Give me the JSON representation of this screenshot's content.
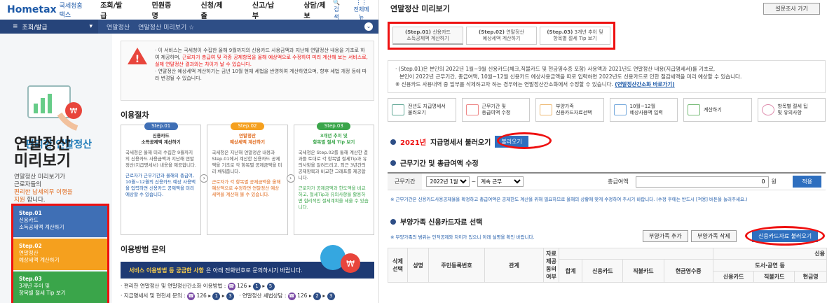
{
  "header": {
    "logo": "Hometax",
    "logo_sub": "국세청홈택스",
    "menu": [
      "조회/발급",
      "민원증명",
      "신청/제출",
      "신고/납부",
      "상담/제보"
    ],
    "search_label": "검색",
    "allmenu_label": "전체메뉴"
  },
  "navbar": {
    "section": "조회/발급",
    "crumb1": "연말정산",
    "crumb2": "연말정산 미리보기"
  },
  "side": {
    "easy_title": "편리한 연말정산",
    "big_title_1": "연말정산",
    "big_title_2": "미리보기",
    "desc_1": "연말정산 미리보기가",
    "desc_2": "근로자들의",
    "desc_hl": "편리한 납세의무 이행을",
    "desc_3": "지원",
    "desc_4": "합니다.",
    "steps": [
      {
        "n": "Step.01",
        "l1": "신용카드",
        "l2": "소득공제액 계산하기"
      },
      {
        "n": "Step.02",
        "l1": "연말정산",
        "l2": "예상세액 계산하기"
      },
      {
        "n": "Step.03",
        "l1": "3개년 추이 및",
        "l2": "항목별 절세 Tip 보기"
      }
    ]
  },
  "notice": {
    "p1a": "· 이 서비스는 국세청이 수집한 올해 9월까지의 신용카드 사용금액과 지난해 연말정산 내용을 기초로 하여 제공하며,",
    "p1b": "근로자가 총급여 및 각종 공제항목을 올해 예상액으로 수정하여 미리 계산해 보는 서비스로, 실제 연말정산 결과와는 차이가 날 수 있습니다.",
    "p2": "· 연말정산 예상세액 계산하기는 금년 10월 현재 세법을 반영하여 계산하였으며, 향후 세법 개정 등에 따라 변경될 수 있습니다."
  },
  "procedure": {
    "title": "이용절차",
    "cards": [
      {
        "badge": "Step.01",
        "t1": "신용카드",
        "t2": "소득공제액 계산하기",
        "body": "국세청은 올해 미리 수집한 9월까지의 신용카드 사용금액과 지난해 연말정산(지급명세서) 내용을 제공합니다.",
        "foot": "근로자가 근무기간과 올해의 총급여, 10월~12월의 신용카드 예상 사용액을 입력하면 신용카드 공제액을 미리 예상할 수 있습니다."
      },
      {
        "badge": "Step.02",
        "t1": "연말정산",
        "t2": "예상세액 계산하기",
        "body": "국세청은 지난해 연말정산 내용과 Step.01에서 계산한 신용카드 공제액을 기초로 각 항목별 공제금액을 미리 채워줍니다.",
        "foot": "근로자가 각 항목별 공제금액을 올해예상액으로 수정하면 연말정산 예상세액을 계산해 볼 수 있습니다."
      },
      {
        "badge": "Step.03",
        "t1": "3개년 추이 및",
        "t2": "항목별 절세 Tip 보기",
        "body": "국세청은 Step.02를 통해 계산한 결과를 토대로 각 항목별 절세Tip과 유의사항을 알려드리고, 최근 3년간의 공제항목과 비교한 그래프를 제공합니다.",
        "foot": "근로자가 공제금액과 한도액을 비교하고, 절세Tip과 유의사항을 활용하면 합리적인 절세계획을 세울 수 있습니다."
      }
    ]
  },
  "inquiry": {
    "title": "이용방법 문의",
    "bar_bold": "서비스 이용방법 등 궁금한 사항",
    "bar_rest": "은 아래 전화번호로 문의하시기 바랍니다.",
    "line1_label": "· 편리한 연말정산 및 연말정산간소화 이용방법 :",
    "line1_num": "126",
    "line2_label": "· 지급명세서 및 현천세 문의 :",
    "line2_num": "126",
    "line3_label": "· 연말정산 세법상담 :",
    "line3_num": "126"
  },
  "right": {
    "title": "연말정산 미리보기",
    "survey": "설문조사 가기",
    "tabs": [
      {
        "n": "(Step.01)",
        "l1": "신용카드",
        "l2": "소득공제액 계산하기"
      },
      {
        "n": "(Step.02)",
        "l1": "연말정산",
        "l2": "예상세액 계산하기"
      },
      {
        "n": "(Step.03)",
        "l1": "3개년 추이 및",
        "l2": "항목별 절세 Tip 보기"
      }
    ],
    "info1": "· (Step.01)은 본인의 2022년 1월~9월 신용카드(체크,직불카드 및 현금영수증 포함) 사용액과 2021년도 연말정산 내용(지급명세서)를 기초로,",
    "info2": "본인이 2022년 근무기간, 총급여액, 10월~12월 신용카드 예상사용금액을 따로 입력하면 2022년도 신용카드로 인한 절감세액을 미리 예상할 수 있습니다.",
    "info3": "※ 신용카드 사용내역 중 일부를 삭제하고자 하는 경우에는 연말정산간소화에서 수정할 수 있습니다.",
    "info_link": "(연말정산간소화 바로가기)",
    "flow": [
      {
        "l1": "전년도 지급명세서",
        "l2": "불러오기"
      },
      {
        "l1": "근무기간 및",
        "l2": "총급여액 수정"
      },
      {
        "l1": "부양가족",
        "l2": "신용카드자료선택"
      },
      {
        "l1": "10월~12월",
        "l2": "예상사용액 입력"
      },
      {
        "l1": "계산하기",
        "l2": ""
      },
      {
        "l1": "항목별 절세 팁",
        "l2": "및 유의사항"
      }
    ],
    "sec1_year": "2021년",
    "sec1_rest": "지급명세서 불러오기",
    "load_btn": "불러오기",
    "sec2": "근무기간 및 총급여액 수정",
    "work_label": "근무기간",
    "work_start": "2022년 1월",
    "work_end": "계속 근무",
    "salary_label": "총급여액",
    "salary_value": "0",
    "won": "원",
    "apply_btn": "적용",
    "note1": "※ 근무기간은 신용카드사용공제율을 확정하고 총급여액은 공제한도 계산을 위해 필요하므로 올해의 상황에 맞게 수정하여 주시기 바랍니다. (수정 후에는 반드시 [적용] 버튼을 눌러주세요.)",
    "sec3": "부양가족 신용카드자료 선택",
    "note2": "※ 부양가족의 범위는 인적공제와 차이가 있으니 아래 설명을 확인 바랍니다.",
    "add_btn": "부양가족 추가",
    "del_btn": "부양가족 삭제",
    "card_btn": "신용카드자료 불러오기",
    "table_headers": [
      "삭제 선택",
      "성명",
      "주민등록번호",
      "관계",
      "자료 제공 동의 여부",
      "합계",
      "신용카드",
      "직불카드",
      "현금영수증",
      "도서·공연 등"
    ],
    "sub_headers": [
      "신용카드",
      "직불카드",
      "현금영"
    ],
    "table_partial": "신용"
  }
}
